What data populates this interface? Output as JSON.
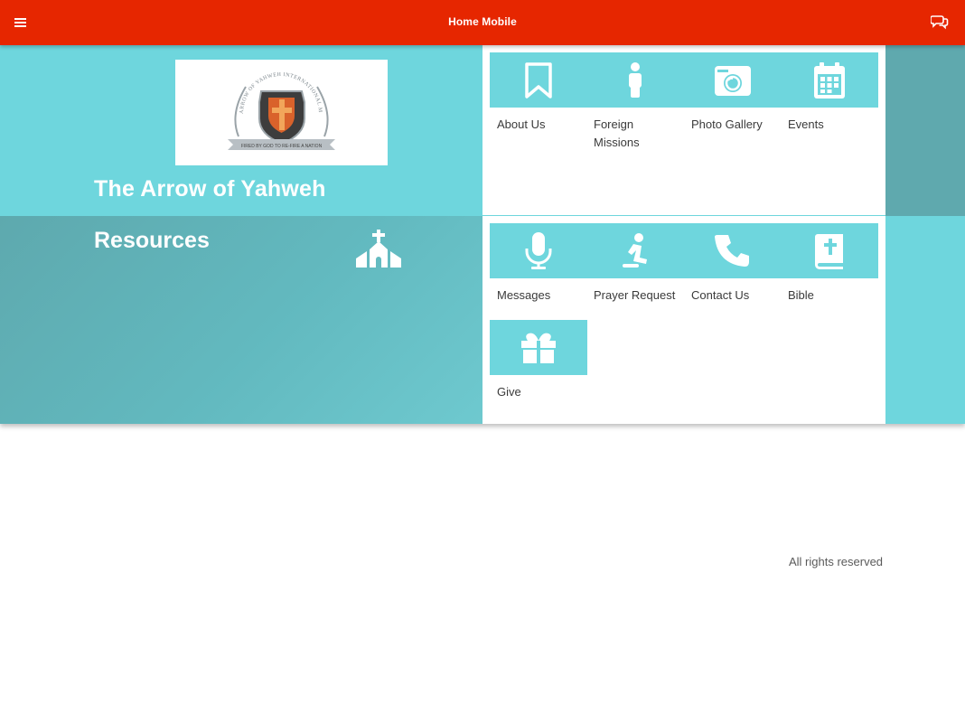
{
  "topbar": {
    "title": "Home Mobile",
    "menu_icon": "hamburger-menu-icon",
    "chat_icon": "chat-bubbles-icon",
    "color": "#e62600"
  },
  "hero": {
    "org_title": "The Arrow of Yahweh",
    "resources_title": "Resources",
    "logo": {
      "seal_text": "ARROW OF YAHWEH INTERNATIONAL MINISTRIES",
      "banner_text": "FIRED BY GOD TO RE-FIRE A NATION"
    },
    "accent": "#6ed6dd",
    "accent_dark": "#5fa9ae"
  },
  "tiles_top": [
    {
      "label": "About Us",
      "icon": "bookmark-icon"
    },
    {
      "label": "Foreign Missions",
      "icon": "person-icon"
    },
    {
      "label": "Photo Gallery",
      "icon": "camera-icon"
    },
    {
      "label": "Events",
      "icon": "calendar-icon"
    }
  ],
  "tiles_bottom": [
    {
      "label": "Messages",
      "icon": "microphone-icon"
    },
    {
      "label": "Prayer Request",
      "icon": "kneeling-person-icon"
    },
    {
      "label": "Contact Us",
      "icon": "phone-icon"
    },
    {
      "label": "Bible",
      "icon": "bible-icon"
    },
    {
      "label": "Give",
      "icon": "gift-icon"
    }
  ],
  "footer": {
    "text": "All rights reserved"
  }
}
